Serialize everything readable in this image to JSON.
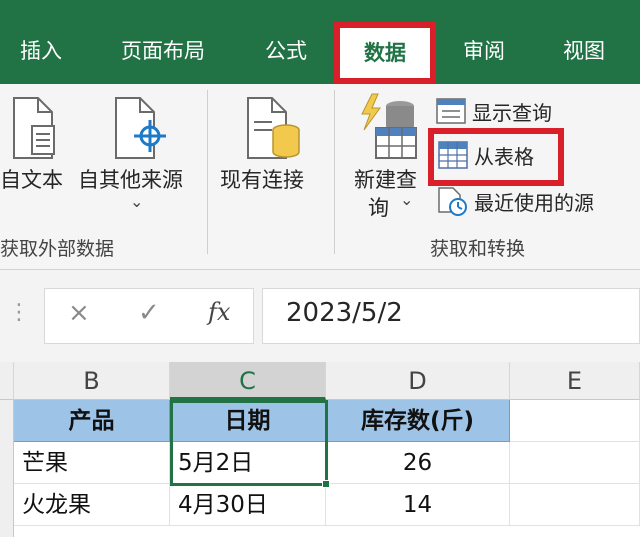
{
  "tabs": [
    "插入",
    "页面布局",
    "公式",
    "数据",
    "审阅",
    "视图"
  ],
  "active_tab": "数据",
  "ribbon": {
    "from_text": "自文本",
    "other_sources": "自其他来源",
    "existing_connections": "现有连接",
    "group_external": "获取外部数据",
    "new_query_line1": "新建查",
    "new_query_line2": "询",
    "show_queries": "显示查询",
    "from_table": "从表格",
    "recent_sources": "最近使用的源",
    "group_transform": "获取和转换"
  },
  "formula_bar": {
    "cancel_symbol": "×",
    "enter_symbol": "✓",
    "fx_symbol": "fx",
    "value": "2023/5/2"
  },
  "columns": [
    "B",
    "C",
    "D",
    "E"
  ],
  "selected_column": "C",
  "table": {
    "headers": [
      "产品",
      "日期",
      "库存数(斤)"
    ],
    "rows": [
      [
        "芒果",
        "5月2日",
        "26"
      ],
      [
        "火龙果",
        "4月30日",
        "14"
      ]
    ]
  },
  "colors": {
    "excel_green": "#217346",
    "header_fill": "#9dc3e6",
    "highlight_red": "#d9202a"
  }
}
